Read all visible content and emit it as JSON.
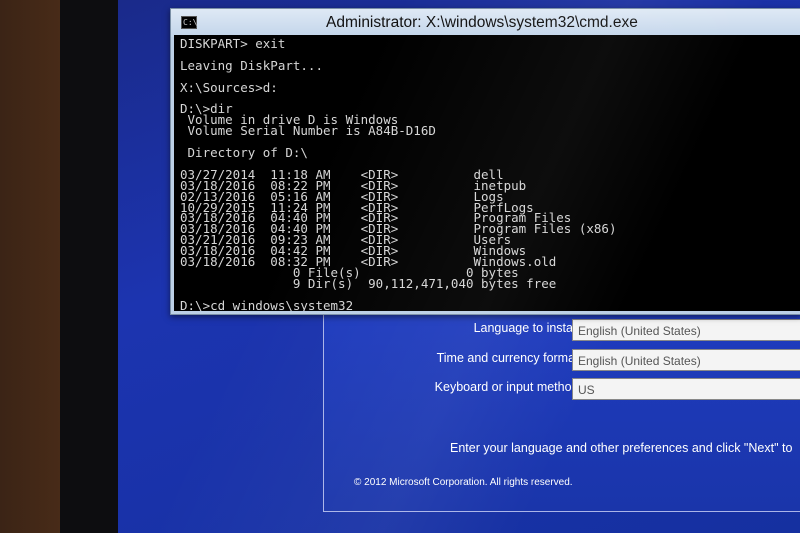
{
  "window": {
    "icon": "cmd-icon",
    "icon_glyph": "C:\\",
    "title": "Administrator: X:\\windows\\system32\\cmd.exe"
  },
  "console": {
    "lines": [
      "DISKPART> exit",
      "",
      "Leaving DiskPart...",
      "",
      "X:\\Sources>d:",
      "",
      "D:\\>dir",
      " Volume in drive D is Windows",
      " Volume Serial Number is A84B-D16D",
      "",
      " Directory of D:\\",
      "",
      "03/27/2014  11:18 AM    <DIR>          dell",
      "03/18/2016  08:22 PM    <DIR>          inetpub",
      "02/13/2016  05:16 AM    <DIR>          Logs",
      "10/29/2015  11:24 PM    <DIR>          PerfLogs",
      "03/18/2016  04:40 PM    <DIR>          Program Files",
      "03/18/2016  04:40 PM    <DIR>          Program Files (x86)",
      "03/21/2016  09:23 AM    <DIR>          Users",
      "03/18/2016  04:42 PM    <DIR>          Windows",
      "03/18/2016  08:32 PM    <DIR>          Windows.old",
      "               0 File(s)              0 bytes",
      "               9 Dir(s)  90,112,471,040 bytes free",
      "",
      "D:\\>cd windows\\system32"
    ]
  },
  "setup": {
    "language_label": "Language to install:",
    "language_value": "English (United States)",
    "time_label": "Time and currency format:",
    "time_value": "English (United States)",
    "keyboard_label": "Keyboard or input method:",
    "keyboard_value": "US",
    "prompt": "Enter your language and other preferences and click \"Next\" to",
    "copyright": "© 2012 Microsoft Corporation. All rights reserved."
  }
}
